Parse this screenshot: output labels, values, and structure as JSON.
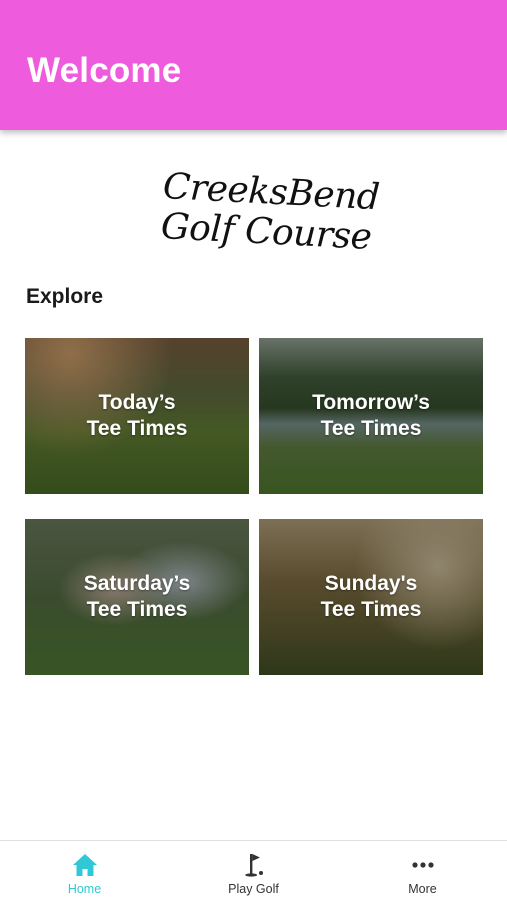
{
  "header": {
    "title": "Welcome",
    "color": "#ee5bdd"
  },
  "logo": {
    "line1": "CreeksBend",
    "line2": "Golf Course"
  },
  "explore": {
    "title": "Explore",
    "cards": [
      {
        "label": "Today’s\nTee Times"
      },
      {
        "label": "Tomorrow’s\nTee Times"
      },
      {
        "label": "Saturday’s\nTee Times"
      },
      {
        "label": "Sunday's\nTee Times"
      }
    ]
  },
  "tabbar": {
    "active_color": "#30c8d6",
    "tabs": [
      {
        "label": "Home",
        "icon": "home-icon",
        "active": true
      },
      {
        "label": "Play Golf",
        "icon": "golf-flag-icon",
        "active": false
      },
      {
        "label": "More",
        "icon": "more-dots-icon",
        "active": false
      }
    ]
  }
}
